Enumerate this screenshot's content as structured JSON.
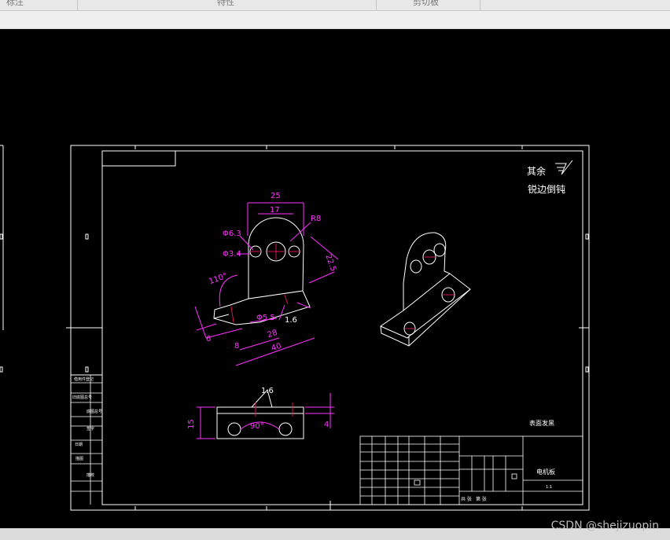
{
  "tabs": [
    {
      "label": "标注"
    },
    {
      "label": "特性"
    },
    {
      "label": "剪切板"
    }
  ],
  "drawing": {
    "surface_note_1": "其余",
    "surface_note_2": "锐边倒钝",
    "dim_25": "25",
    "dim_17": "17",
    "dim_r8": "R8",
    "dim_phi63": "Φ6.3",
    "dim_phi34": "Φ3.4",
    "dim_225": "22.5",
    "dim_110": "110°",
    "dim_phi55": "Φ5.5",
    "dim_16a": "1.6",
    "dim_6": "6",
    "dim_8": "8",
    "dim_28": "28",
    "dim_40": "40",
    "dim_16b": "1.6",
    "dim_15": "15",
    "dim_4": "4",
    "dim_90": "90°",
    "tech_req": "表面发黑",
    "part_name": "电机板",
    "scale": "1:1",
    "footer_1": "共 张",
    "footer_2": "第 张",
    "side_labels": [
      "借用件登记",
      "旧底图总号",
      "底图总号",
      "签字",
      "日期",
      "描图",
      "描校"
    ]
  },
  "watermark": "CSDN @shejizuopin"
}
